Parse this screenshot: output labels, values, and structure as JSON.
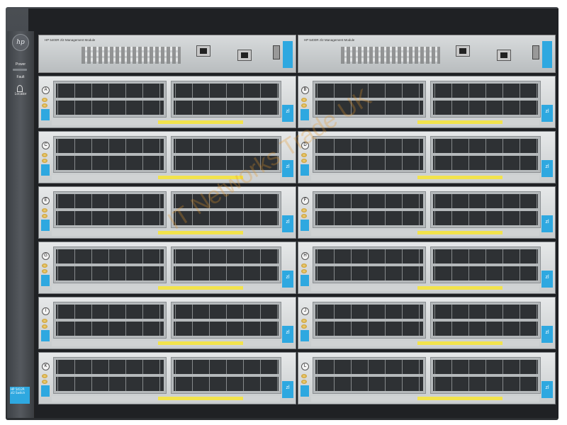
{
  "image": {
    "subject": "HP 5412R zl2 switch chassis",
    "left_panel": {
      "logo": "hp",
      "labels": [
        "Power",
        "Fault",
        "Locator"
      ],
      "product_label": "HP 5412R zl2 Switch"
    },
    "management_modules": [
      {
        "title": "HP 5400R zl2 Management Module"
      },
      {
        "title": "HP 5400R zl2 Management Module"
      }
    ],
    "slots": [
      {
        "letter": "A",
        "type": "zl"
      },
      {
        "letter": "B",
        "type": "zl"
      },
      {
        "letter": "C",
        "type": "zl"
      },
      {
        "letter": "D",
        "type": "zl"
      },
      {
        "letter": "E",
        "type": "zl"
      },
      {
        "letter": "F",
        "type": "zl"
      },
      {
        "letter": "G",
        "type": "zl"
      },
      {
        "letter": "H",
        "type": "zl"
      },
      {
        "letter": "I",
        "type": "zl"
      },
      {
        "letter": "J",
        "type": "zl"
      },
      {
        "letter": "K",
        "type": "zl"
      },
      {
        "letter": "L",
        "type": "zl"
      }
    ],
    "watermark": "IT Networks Trade UK",
    "colors": {
      "accent": "#2ea8e0",
      "chassis": "#3a3d41",
      "faceplate": "#d8dbdc"
    }
  }
}
